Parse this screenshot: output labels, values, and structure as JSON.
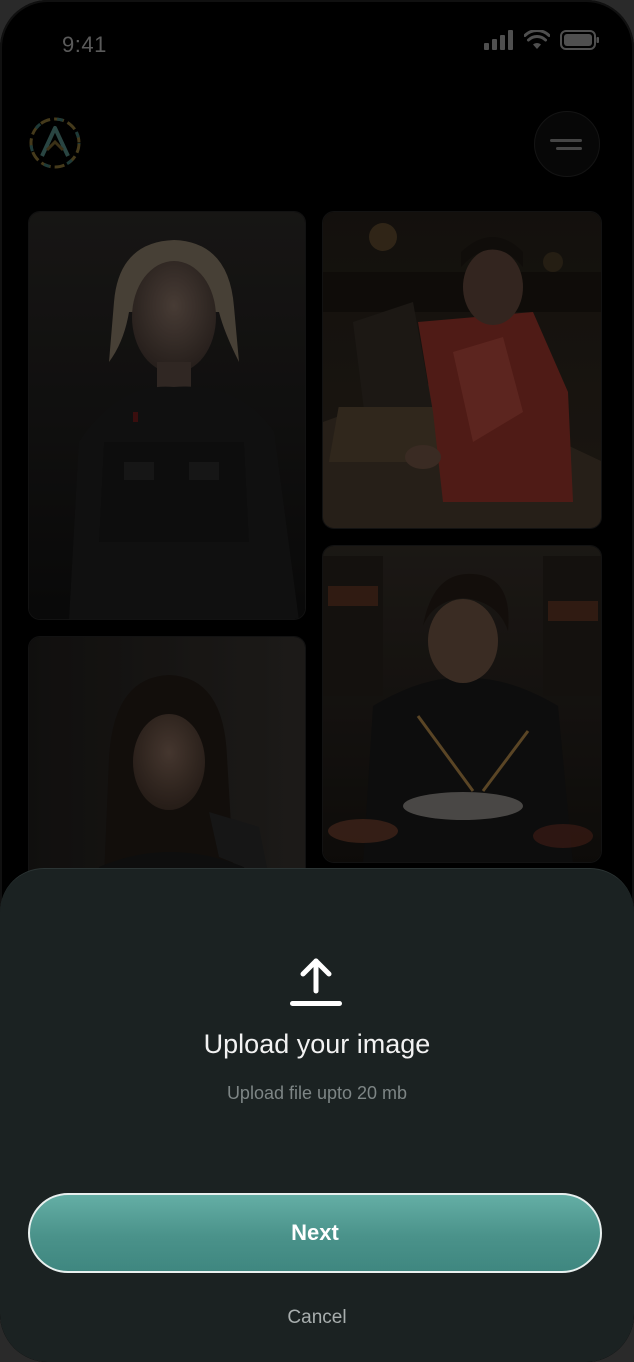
{
  "status_bar": {
    "time": "9:41",
    "icons": [
      "signal-icon",
      "wifi-icon",
      "battery-icon"
    ]
  },
  "header": {
    "logo_icon": "app-logo-icon",
    "menu_icon": "menu-icon"
  },
  "gallery": {
    "images": [
      {
        "name": "woman-tactical-portrait"
      },
      {
        "name": "man-arcade-red-shirt"
      },
      {
        "name": "man-sushi-chopsticks"
      },
      {
        "name": "woman-dark-hair-portrait"
      }
    ]
  },
  "upload_sheet": {
    "icon": "upload-icon",
    "title": "Upload your image",
    "subtitle": "Upload file upto 20 mb",
    "next_label": "Next",
    "cancel_label": "Cancel"
  },
  "colors": {
    "accent": "#4f9a91",
    "sheet_bg": "#1b2222",
    "background": "#000000"
  }
}
